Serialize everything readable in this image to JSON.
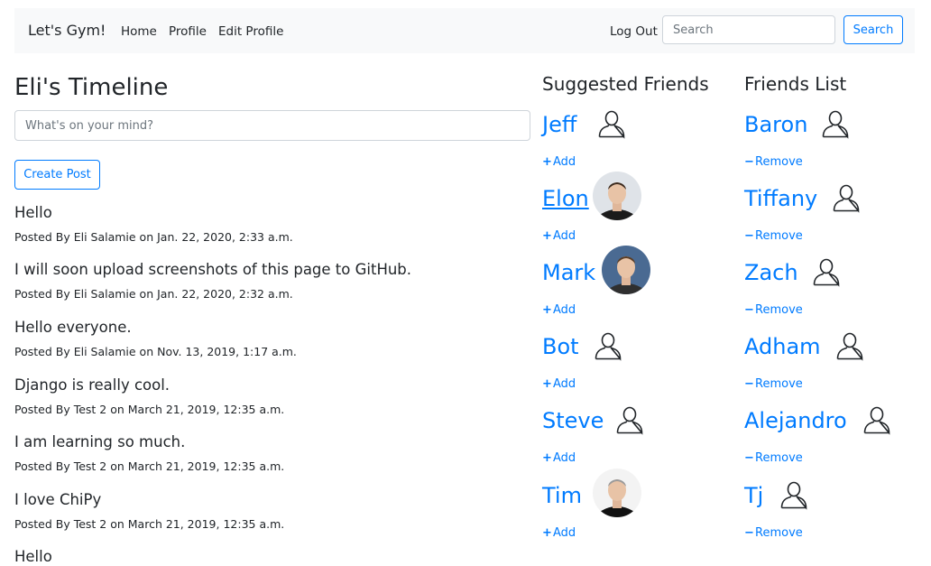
{
  "navbar": {
    "brand": "Let's Gym!",
    "links": [
      "Home",
      "Profile",
      "Edit Profile"
    ],
    "logout": "Log Out",
    "search_placeholder": "Search",
    "search_button": "Search"
  },
  "timeline": {
    "title": "Eli's Timeline",
    "post_placeholder": "What's on your mind?",
    "create_button": "Create Post",
    "posts": [
      {
        "text": "Hello",
        "meta": "Posted By Eli Salamie on Jan. 22, 2020, 2:33 a.m."
      },
      {
        "text": "I will soon upload screenshots of this page to GitHub.",
        "meta": "Posted By Eli Salamie on Jan. 22, 2020, 2:32 a.m."
      },
      {
        "text": "Hello everyone.",
        "meta": "Posted By Eli Salamie on Nov. 13, 2019, 1:17 a.m."
      },
      {
        "text": "Django is really cool.",
        "meta": "Posted By Test 2 on March 21, 2019, 12:35 a.m."
      },
      {
        "text": "I am learning so much.",
        "meta": "Posted By Test 2 on March 21, 2019, 12:35 a.m."
      },
      {
        "text": "I love ChiPy",
        "meta": "Posted By Test 2 on March 21, 2019, 12:35 a.m."
      },
      {
        "text": "Hello",
        "meta": ""
      }
    ]
  },
  "suggested": {
    "title": "Suggested Friends",
    "action_label": "Add",
    "action_symbol": "+",
    "friends": [
      {
        "name": "Jeff",
        "avatar": "user-outline-icon"
      },
      {
        "name": "Elon",
        "avatar": "photo"
      },
      {
        "name": "Mark",
        "avatar": "photo"
      },
      {
        "name": "Bot",
        "avatar": "user-outline-icon"
      },
      {
        "name": "Steve",
        "avatar": "user-outline-icon"
      },
      {
        "name": "Tim",
        "avatar": "photo"
      }
    ]
  },
  "friends_list": {
    "title": "Friends List",
    "action_label": "Remove",
    "action_symbol": "−",
    "friends": [
      {
        "name": "Baron",
        "avatar": "user-outline-icon"
      },
      {
        "name": "Tiffany",
        "avatar": "user-outline-icon"
      },
      {
        "name": "Zach",
        "avatar": "user-outline-icon"
      },
      {
        "name": "Adham",
        "avatar": "user-outline-icon"
      },
      {
        "name": "Alejandro",
        "avatar": "user-outline-icon"
      },
      {
        "name": "Tj",
        "avatar": "user-outline-icon"
      }
    ]
  },
  "colors": {
    "link": "#007bff",
    "navbar_bg": "#f8f9fa",
    "text": "#212529"
  }
}
